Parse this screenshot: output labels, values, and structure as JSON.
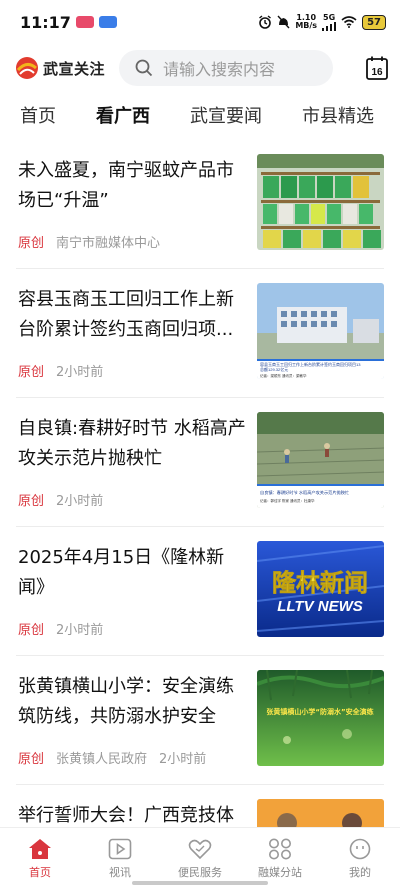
{
  "status": {
    "time": "11:17",
    "net_speed_value": "1.10",
    "net_speed_unit": "MB/s",
    "signal": "5G",
    "battery": "57"
  },
  "header": {
    "logo_text": "武宣关注",
    "search_placeholder": "请输入搜索内容",
    "calendar_day": "16"
  },
  "tabs": [
    {
      "label": "首页"
    },
    {
      "label": "看广西"
    },
    {
      "label": "武宣要闻"
    },
    {
      "label": "市县精选"
    }
  ],
  "news": [
    {
      "title": "未入盛夏，南宁驱蚊产品市场已“升温”",
      "tag": "原创",
      "source": "南宁市融媒体中心",
      "time": "",
      "thumb_icon": "mosquito-products-shelf"
    },
    {
      "title": "容县玉商玉工回归工作上新台阶累计签约玉商回归项...",
      "tag": "原创",
      "source": "",
      "time": "2小时前",
      "thumb_icon": "factory-building",
      "thumb_caption": "容县玉商玉工回归工作上新台阶累计签约玉商回归项目13",
      "thumb_caption2": "总额129.32亿元",
      "thumb_reporter": "记者：梁顺东 通讯员：梁敏华"
    },
    {
      "title": "自良镇:春耕好时节  水稻高产攻关示范片抛秧忙",
      "tag": "原创",
      "source": "",
      "time": "2小时前",
      "thumb_icon": "rice-field",
      "thumb_caption": "自良镇：春耕好时节  水稻高产攻关示范片抛秧忙",
      "thumb_reporter": "记者：郭佳宇  陈家  通讯员：杜康华"
    },
    {
      "title": "2025年4月15日《隆林新闻》",
      "tag": "原创",
      "source": "",
      "time": "2小时前",
      "thumb_icon": "news-title-card",
      "thumb_caption": "隆林新闻",
      "thumb_caption2": "LLTV NEWS"
    },
    {
      "title": "张黄镇横山小学：安全演练筑防线，共防溺水护安全",
      "tag": "原创",
      "source": "张黄镇人民政府",
      "time": "2小时前",
      "thumb_icon": "green-forest-banner",
      "thumb_caption": "张黄镇横山小学“防溺水”安全演练"
    },
    {
      "title": "举行誓师大会！广西竞技体",
      "tag": "",
      "source": "",
      "time": "",
      "thumb_icon": "sports-photo"
    }
  ],
  "bottom_nav": [
    {
      "label": "首页",
      "icon": "home-icon",
      "active": true
    },
    {
      "label": "视讯",
      "icon": "play-icon",
      "active": false
    },
    {
      "label": "便民服务",
      "icon": "heart-hands-icon",
      "active": false
    },
    {
      "label": "融媒分站",
      "icon": "grid-icon",
      "active": false
    },
    {
      "label": "我的",
      "icon": "smile-icon",
      "active": false
    }
  ],
  "colors": {
    "accent": "#d9363e",
    "tag_red": "#d9363e",
    "muted": "#9a9a9a"
  }
}
